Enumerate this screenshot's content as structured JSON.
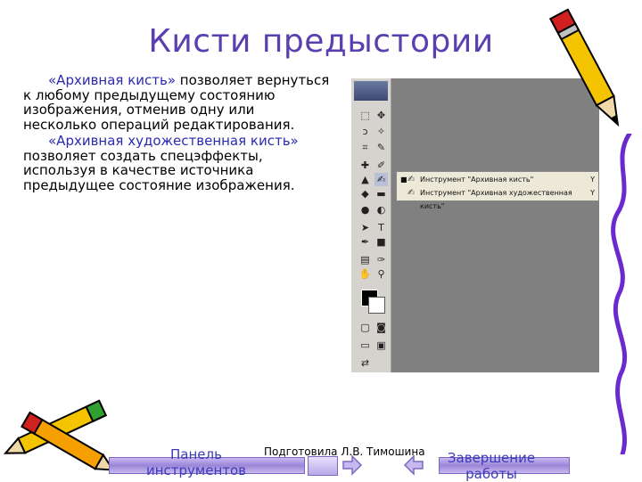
{
  "slide": {
    "title": "Кисти предыстории",
    "paragraph1_highlight": "«Архивная кисть»",
    "paragraph1_rest": " позволяет вернуться к любому предыдущему состоянию изображения, отменив одну или несколько операций редактирования.",
    "paragraph2_highlight": "«Архивная художественная кисть»",
    "paragraph2_rest": " позволяет создать спецэффекты, используя в качестве источника предыдущее состояние изображения."
  },
  "screenshot": {
    "flyout_items": [
      {
        "label": "Инструмент \"Архивная кисть\"",
        "shortcut": "Y",
        "bullet": "■"
      },
      {
        "label": "Инструмент \"Архивная художественная кисть\"",
        "shortcut": "Y",
        "bullet": ""
      }
    ]
  },
  "footer": {
    "author": "Подготовила Л.В. Тимошина",
    "nav_left_label": "Панель инструментов",
    "nav_right_label": "Завершение работы"
  },
  "colors": {
    "title": "#5a3fb0",
    "highlight": "#2a2ab0",
    "nav_bar": "#9a86d8",
    "nav_text": "#3b3bb8"
  }
}
